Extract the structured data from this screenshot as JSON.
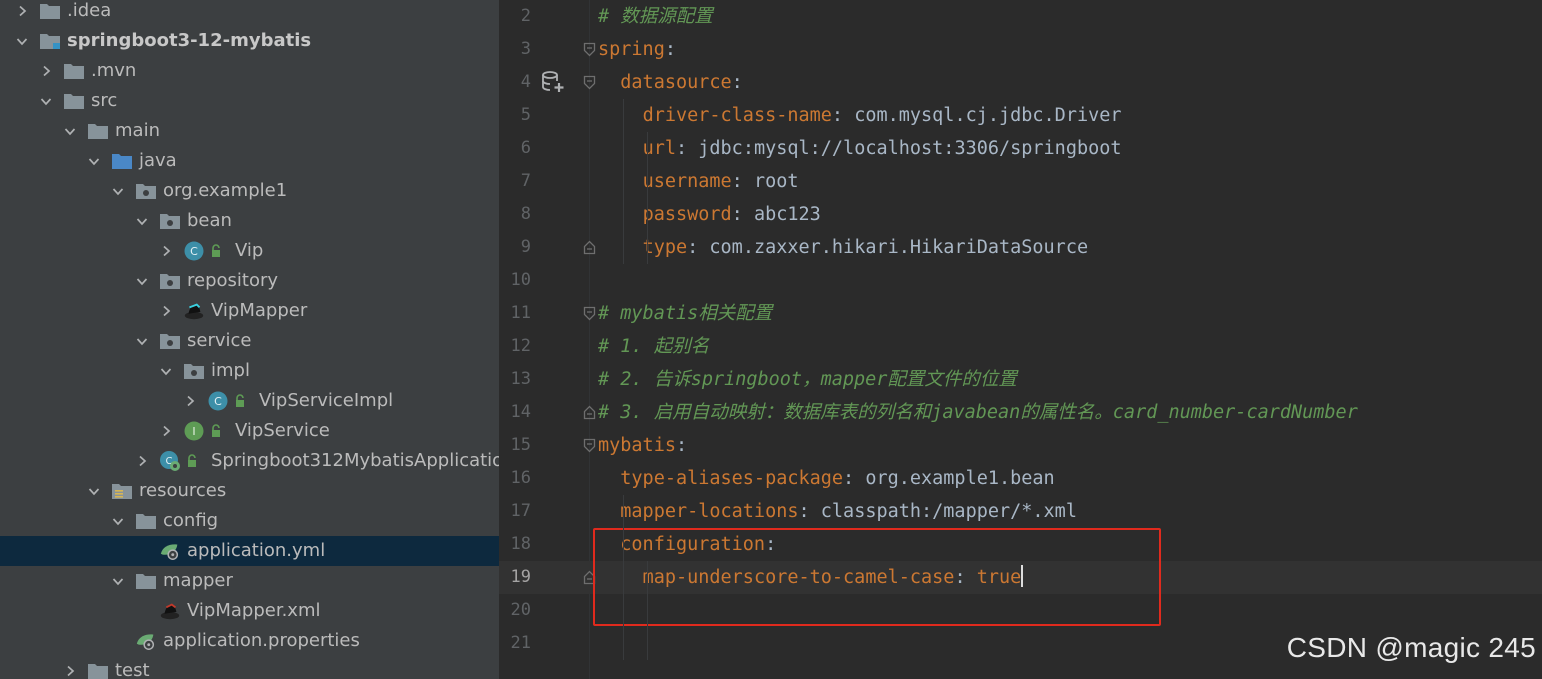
{
  "tree": {
    "rows": [
      {
        "label": ".idea",
        "icon": "folder-icon",
        "expanded": false
      },
      {
        "label": "springboot3-12-mybatis",
        "icon": "module-icon",
        "expanded": true
      },
      {
        "label": ".mvn",
        "icon": "folder-icon",
        "expanded": false
      },
      {
        "label": "src",
        "icon": "folder-icon",
        "expanded": true
      },
      {
        "label": "main",
        "icon": "folder-icon",
        "expanded": true
      },
      {
        "label": "java",
        "icon": "source-root-icon",
        "expanded": true
      },
      {
        "label": "org.example1",
        "icon": "package-icon",
        "expanded": true
      },
      {
        "label": "bean",
        "icon": "package-icon",
        "expanded": true
      },
      {
        "label": "Vip",
        "icon": "class-icon",
        "expanded": false
      },
      {
        "label": "repository",
        "icon": "package-icon",
        "expanded": true
      },
      {
        "label": "VipMapper",
        "icon": "mybatis-mapper-icon",
        "expanded": false
      },
      {
        "label": "service",
        "icon": "package-icon",
        "expanded": true
      },
      {
        "label": "impl",
        "icon": "package-icon",
        "expanded": true
      },
      {
        "label": "VipServiceImpl",
        "icon": "class-icon",
        "expanded": false
      },
      {
        "label": "VipService",
        "icon": "interface-icon",
        "expanded": false
      },
      {
        "label": "Springboot312MybatisApplicatio",
        "icon": "spring-boot-class-icon",
        "expanded": false
      },
      {
        "label": "resources",
        "icon": "resources-folder-icon",
        "expanded": true
      },
      {
        "label": "config",
        "icon": "folder-icon",
        "expanded": true
      },
      {
        "label": "application.yml",
        "icon": "spring-config-icon",
        "selected": true
      },
      {
        "label": "mapper",
        "icon": "folder-icon",
        "expanded": true
      },
      {
        "label": "VipMapper.xml",
        "icon": "mybatis-xml-icon"
      },
      {
        "label": "application.properties",
        "icon": "spring-config-icon"
      },
      {
        "label": "test",
        "icon": "folder-icon",
        "expanded": false
      }
    ]
  },
  "editor": {
    "lines": [
      {
        "num": "2",
        "tokens": [
          {
            "t": "# 数据源配置",
            "c": "c"
          }
        ]
      },
      {
        "num": "3",
        "tokens": [
          {
            "t": "spring",
            "c": "k"
          },
          {
            "t": ":",
            "c": "v"
          }
        ]
      },
      {
        "num": "4",
        "tokens": [
          {
            "t": "  "
          },
          {
            "t": "datasource",
            "c": "k"
          },
          {
            "t": ":",
            "c": "v"
          }
        ]
      },
      {
        "num": "5",
        "tokens": [
          {
            "t": "    "
          },
          {
            "t": "driver-class-name",
            "c": "k"
          },
          {
            "t": ": ",
            "c": "v"
          },
          {
            "t": "com.mysql.cj.jdbc.Driver",
            "c": "v"
          }
        ]
      },
      {
        "num": "6",
        "tokens": [
          {
            "t": "    "
          },
          {
            "t": "url",
            "c": "k"
          },
          {
            "t": ": ",
            "c": "v"
          },
          {
            "t": "jdbc:mysql://localhost:3306/springboot",
            "c": "v"
          }
        ]
      },
      {
        "num": "7",
        "tokens": [
          {
            "t": "    "
          },
          {
            "t": "username",
            "c": "k"
          },
          {
            "t": ": ",
            "c": "v"
          },
          {
            "t": "root",
            "c": "v"
          }
        ]
      },
      {
        "num": "8",
        "tokens": [
          {
            "t": "    "
          },
          {
            "t": "password",
            "c": "k"
          },
          {
            "t": ": ",
            "c": "v"
          },
          {
            "t": "abc123",
            "c": "v"
          }
        ]
      },
      {
        "num": "9",
        "tokens": [
          {
            "t": "    "
          },
          {
            "t": "type",
            "c": "k"
          },
          {
            "t": ": ",
            "c": "v"
          },
          {
            "t": "com.zaxxer.hikari.HikariDataSource",
            "c": "v"
          }
        ]
      },
      {
        "num": "10",
        "tokens": []
      },
      {
        "num": "11",
        "tokens": [
          {
            "t": "# mybatis相关配置",
            "c": "c"
          }
        ]
      },
      {
        "num": "12",
        "tokens": [
          {
            "t": "# 1. 起别名",
            "c": "c"
          }
        ]
      },
      {
        "num": "13",
        "tokens": [
          {
            "t": "# 2. 告诉springboot，mapper配置文件的位置",
            "c": "c"
          }
        ]
      },
      {
        "num": "14",
        "tokens": [
          {
            "t": "# 3. 启用自动映射：数据库表的列名和javabean的属性名。card_number-cardNumber",
            "c": "c"
          }
        ]
      },
      {
        "num": "15",
        "tokens": [
          {
            "t": "mybatis",
            "c": "k"
          },
          {
            "t": ":",
            "c": "v"
          }
        ]
      },
      {
        "num": "16",
        "tokens": [
          {
            "t": "  "
          },
          {
            "t": "type-aliases-package",
            "c": "k"
          },
          {
            "t": ": ",
            "c": "v"
          },
          {
            "t": "org.example1.bean",
            "c": "v"
          }
        ]
      },
      {
        "num": "17",
        "tokens": [
          {
            "t": "  "
          },
          {
            "t": "mapper-locations",
            "c": "k"
          },
          {
            "t": ": ",
            "c": "v"
          },
          {
            "t": "classpath:/mapper/*.xml",
            "c": "v"
          }
        ]
      },
      {
        "num": "18",
        "tokens": [
          {
            "t": "  "
          },
          {
            "t": "configuration",
            "c": "k"
          },
          {
            "t": ":",
            "c": "v"
          }
        ]
      },
      {
        "num": "19",
        "tokens": [
          {
            "t": "    "
          },
          {
            "t": "map-underscore-to-camel-case",
            "c": "k"
          },
          {
            "t": ": ",
            "c": "v"
          },
          {
            "t": "true",
            "c": "k"
          }
        ],
        "current": true,
        "caret": true
      },
      {
        "num": "20",
        "tokens": []
      },
      {
        "num": "21",
        "tokens": []
      }
    ]
  },
  "watermark": "CSDN @magic 245",
  "colors": {
    "tree_bg": "#3c3f41",
    "editor_bg": "#2b2b2b",
    "selection": "#0d293e",
    "key": "#cc7832",
    "comment": "#629755",
    "text": "#a9b7c6",
    "highlight_box": "#e02a1d"
  }
}
